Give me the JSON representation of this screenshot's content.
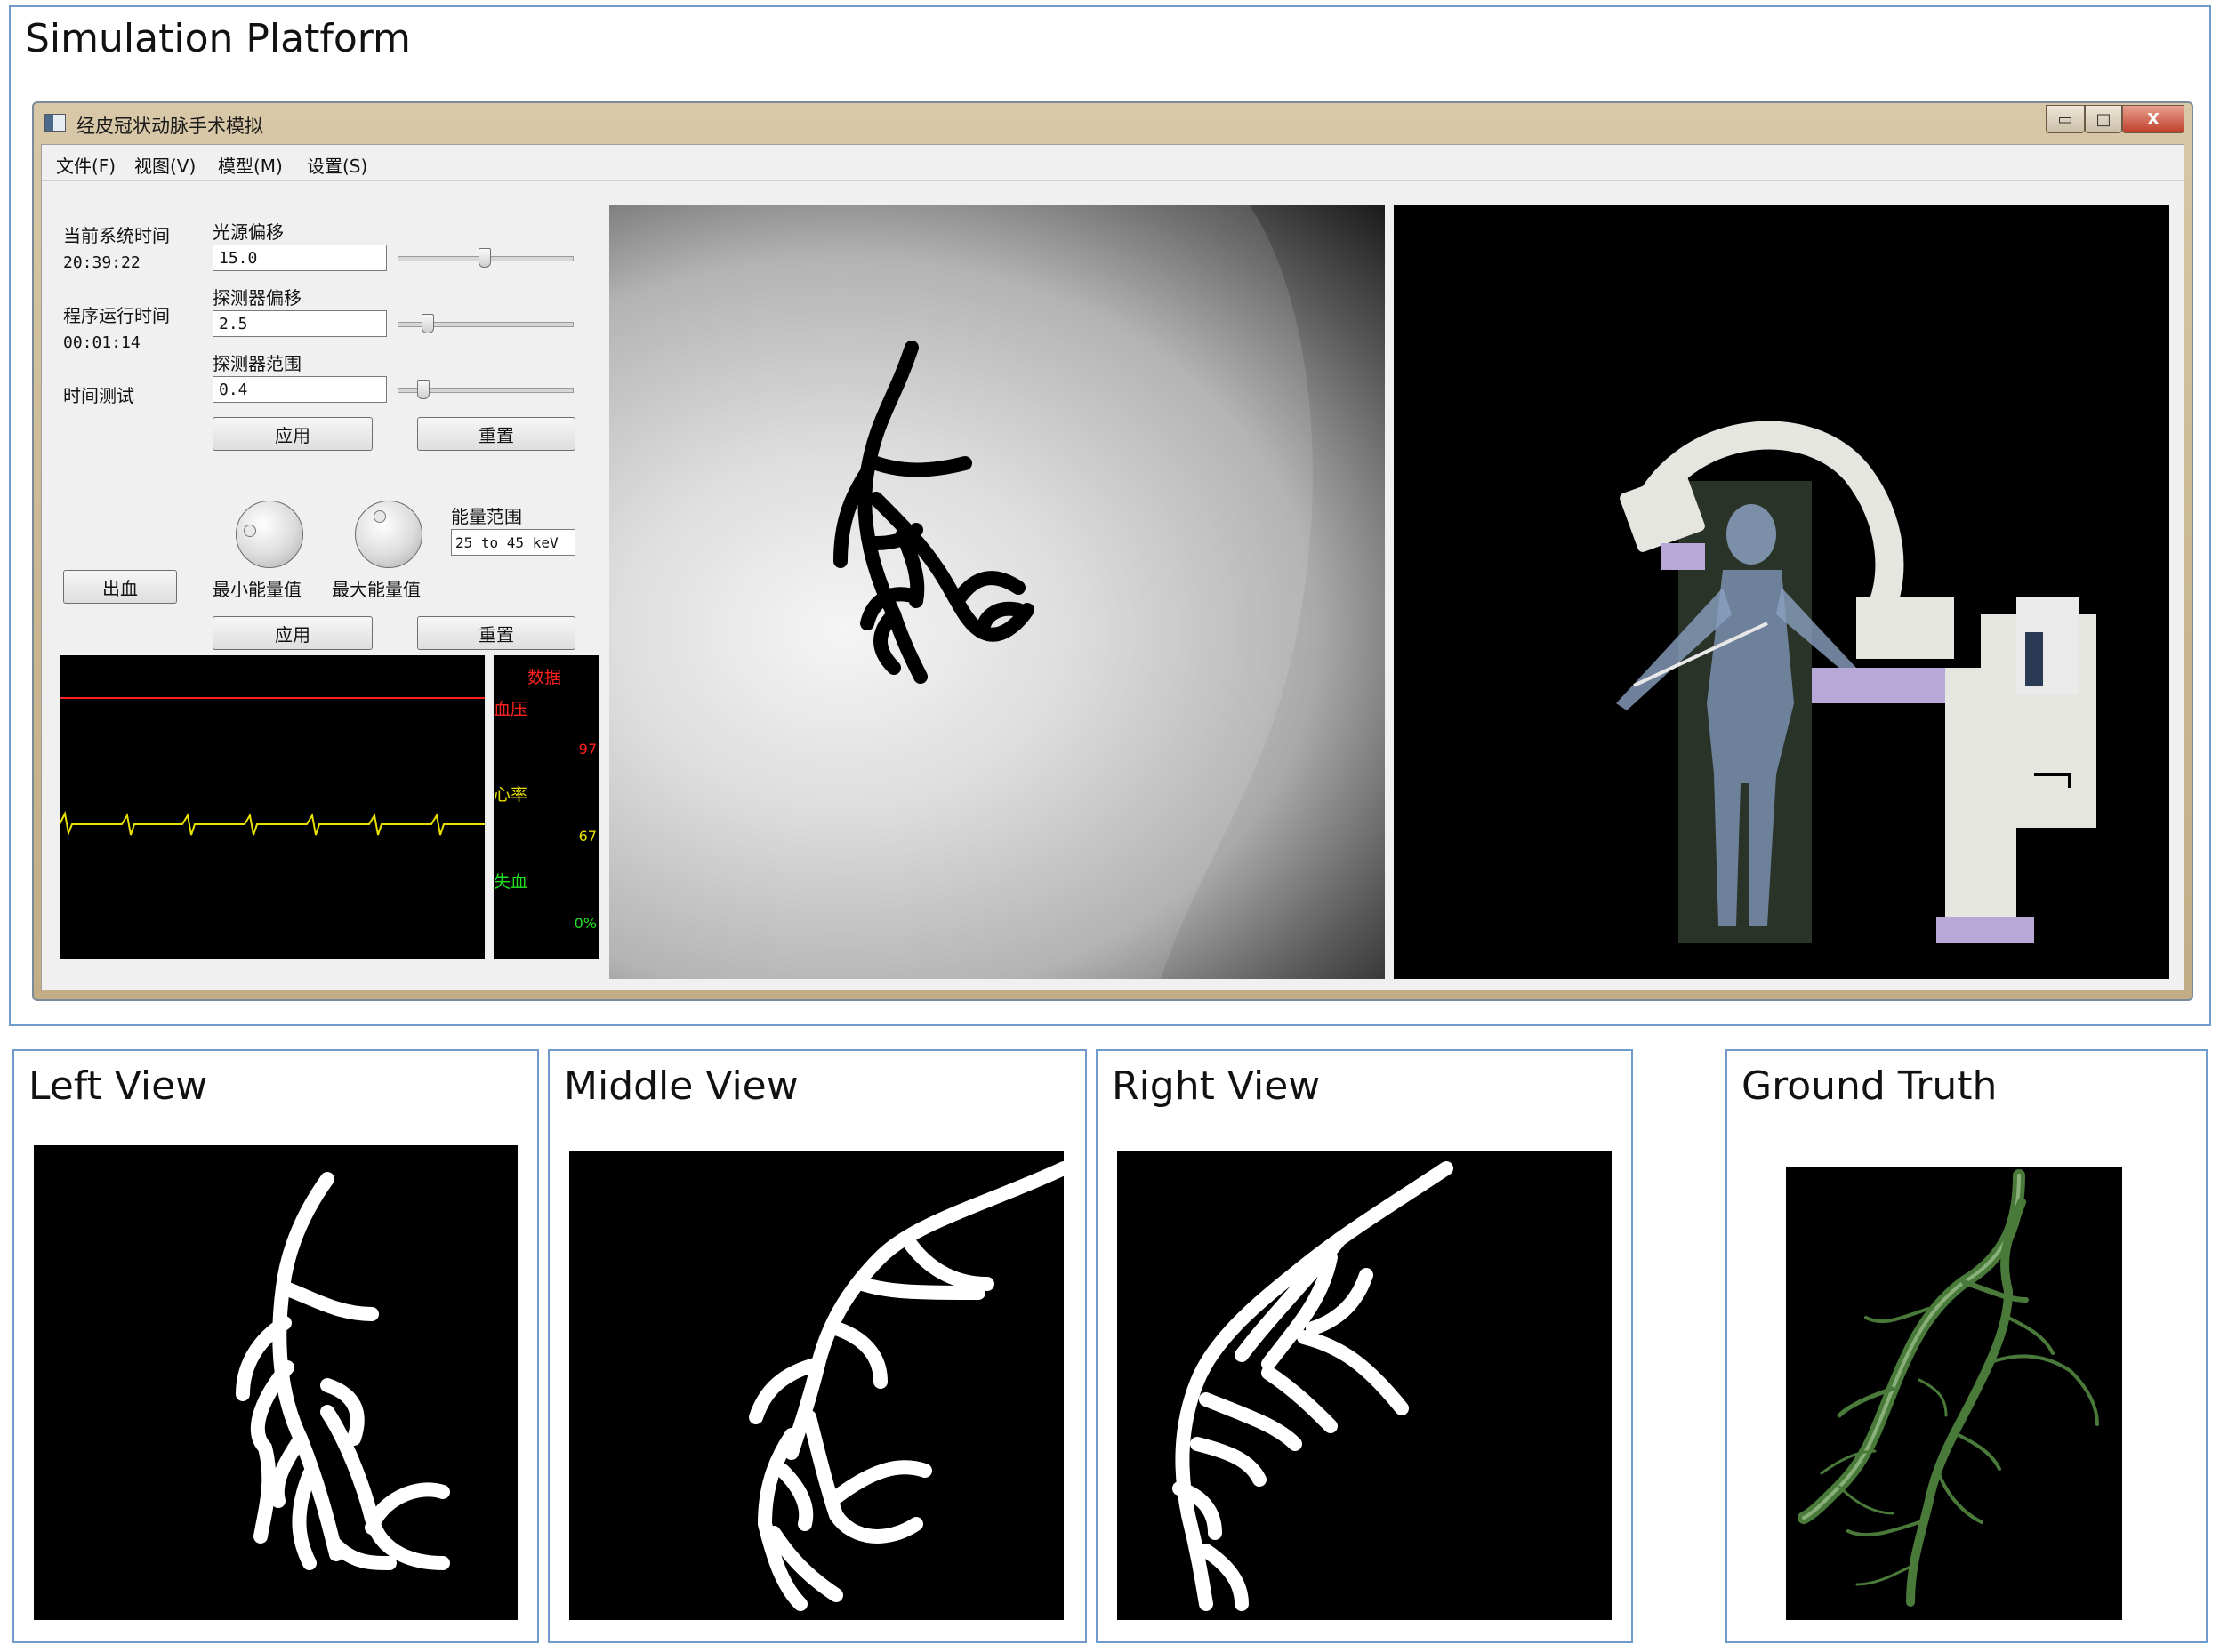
{
  "figure": {
    "top_title": "Simulation Platform",
    "bottom_titles": [
      "Left View",
      "Middle View",
      "Right View",
      "Ground Truth"
    ]
  },
  "window": {
    "title": "经皮冠状动脉手术模拟",
    "controls": {
      "minimize": "▭",
      "maximize": "□",
      "close": "X"
    },
    "menu": [
      "文件(F)",
      "视图(V)",
      "模型(M)",
      "设置(S)"
    ]
  },
  "left_panel": {
    "current_time_label": "当前系统时间",
    "current_time_value": "20:39:22",
    "run_time_label": "程序运行时间",
    "run_time_value": "00:01:14",
    "time_test_label": "时间测试",
    "bleed_button": "出血"
  },
  "controls_panel": {
    "light_offset_label": "光源偏移",
    "light_offset_value": "15.0",
    "light_offset_slider": 0.5,
    "detector_offset_label": "探测器偏移",
    "detector_offset_value": "2.5",
    "detector_offset_slider": 0.15,
    "detector_range_label": "探测器范围",
    "detector_range_value": "0.4",
    "detector_range_slider": 0.12,
    "apply_label": "应用",
    "reset_label": "重置",
    "energy_range_label": "能量范围",
    "energy_range_value": "25 to 45 keV",
    "min_energy_label": "最小能量值",
    "max_energy_label": "最大能量值"
  },
  "monitor": {
    "header": "数据",
    "bp_label": "血压",
    "bp_value": "97",
    "hr_label": "心率",
    "hr_value": "67",
    "blood_loss_label": "失血",
    "blood_loss_value": "0%"
  },
  "colors": {
    "panel_border": "#6f9ccc",
    "bp_color": "#ff2020",
    "hr_color": "#e8e000",
    "blood_loss_color": "#20e020",
    "vessel_green": "#4a7a3a"
  },
  "icons": [
    "app-icon",
    "minimize-icon",
    "maximize-icon",
    "close-icon",
    "knob-min-energy",
    "knob-max-energy"
  ]
}
